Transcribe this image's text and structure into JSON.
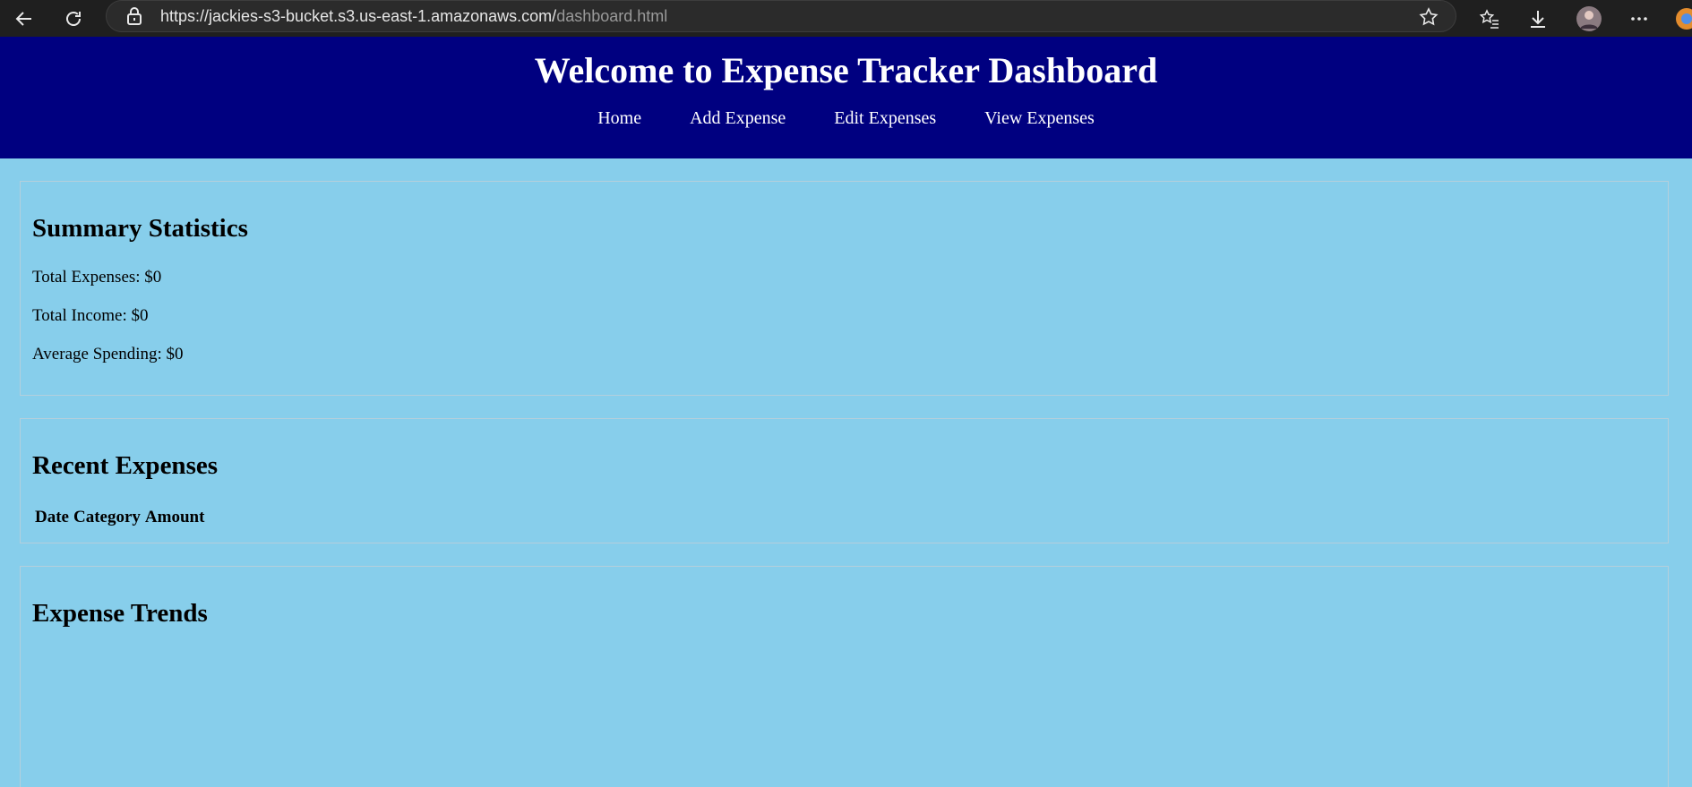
{
  "browser": {
    "url_host": "https://jackies-s3-bucket.s3.us-east-1.amazonaws.com/",
    "url_path": "dashboard.html"
  },
  "header": {
    "title": "Welcome to Expense Tracker Dashboard",
    "nav": [
      "Home",
      "Add Expense",
      "Edit Expenses",
      "View Expenses"
    ]
  },
  "summary": {
    "heading": "Summary Statistics",
    "total_expenses": "Total Expenses: $0",
    "total_income": "Total Income: $0",
    "average_spending": "Average Spending: $0"
  },
  "recent": {
    "heading": "Recent Expenses",
    "columns": [
      "Date",
      "Category",
      "Amount"
    ]
  },
  "trends": {
    "heading": "Expense Trends"
  },
  "colors": {
    "header_bg": "#000080",
    "page_bg": "#87ceeb"
  }
}
